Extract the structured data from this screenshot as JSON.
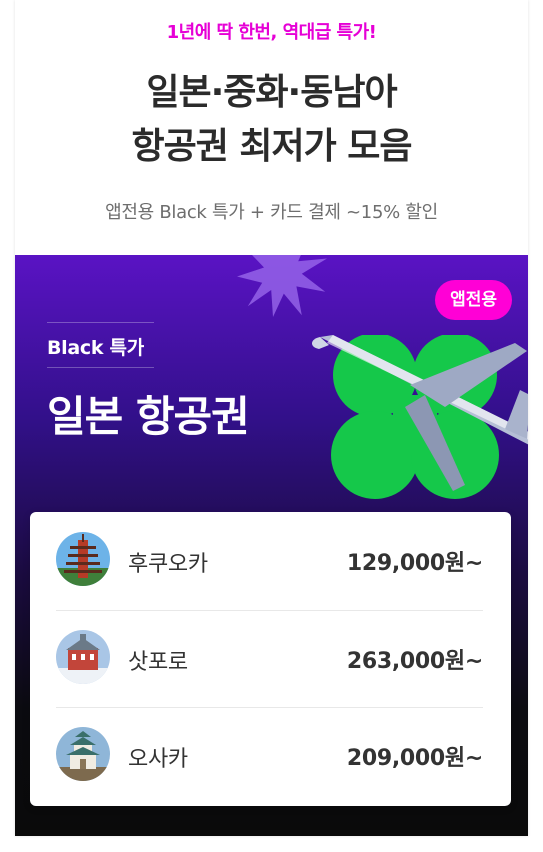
{
  "header": {
    "kicker": "1년에 딱 한번, 역대급 특가!",
    "kicker_color": "#e600d6",
    "title_line1": "일본·중화·동남아",
    "title_line2": "항공권 최저가 모음",
    "subtitle": "앱전용 Black 특가 + 카드 결제 ~15% 할인"
  },
  "promo": {
    "badge": "앱전용",
    "badge_color": "#ff00d6",
    "label": "Black 특가",
    "title": "일본 항공권",
    "art_icons": [
      "starburst",
      "four-leaf-clover",
      "airplane"
    ]
  },
  "flights": [
    {
      "city": "후쿠오카",
      "price": "129,000원~",
      "thumb": "pagoda"
    },
    {
      "city": "삿포로",
      "price": "263,000원~",
      "thumb": "snowy-building"
    },
    {
      "city": "오사카",
      "price": "209,000원~",
      "thumb": "osaka-castle"
    }
  ]
}
